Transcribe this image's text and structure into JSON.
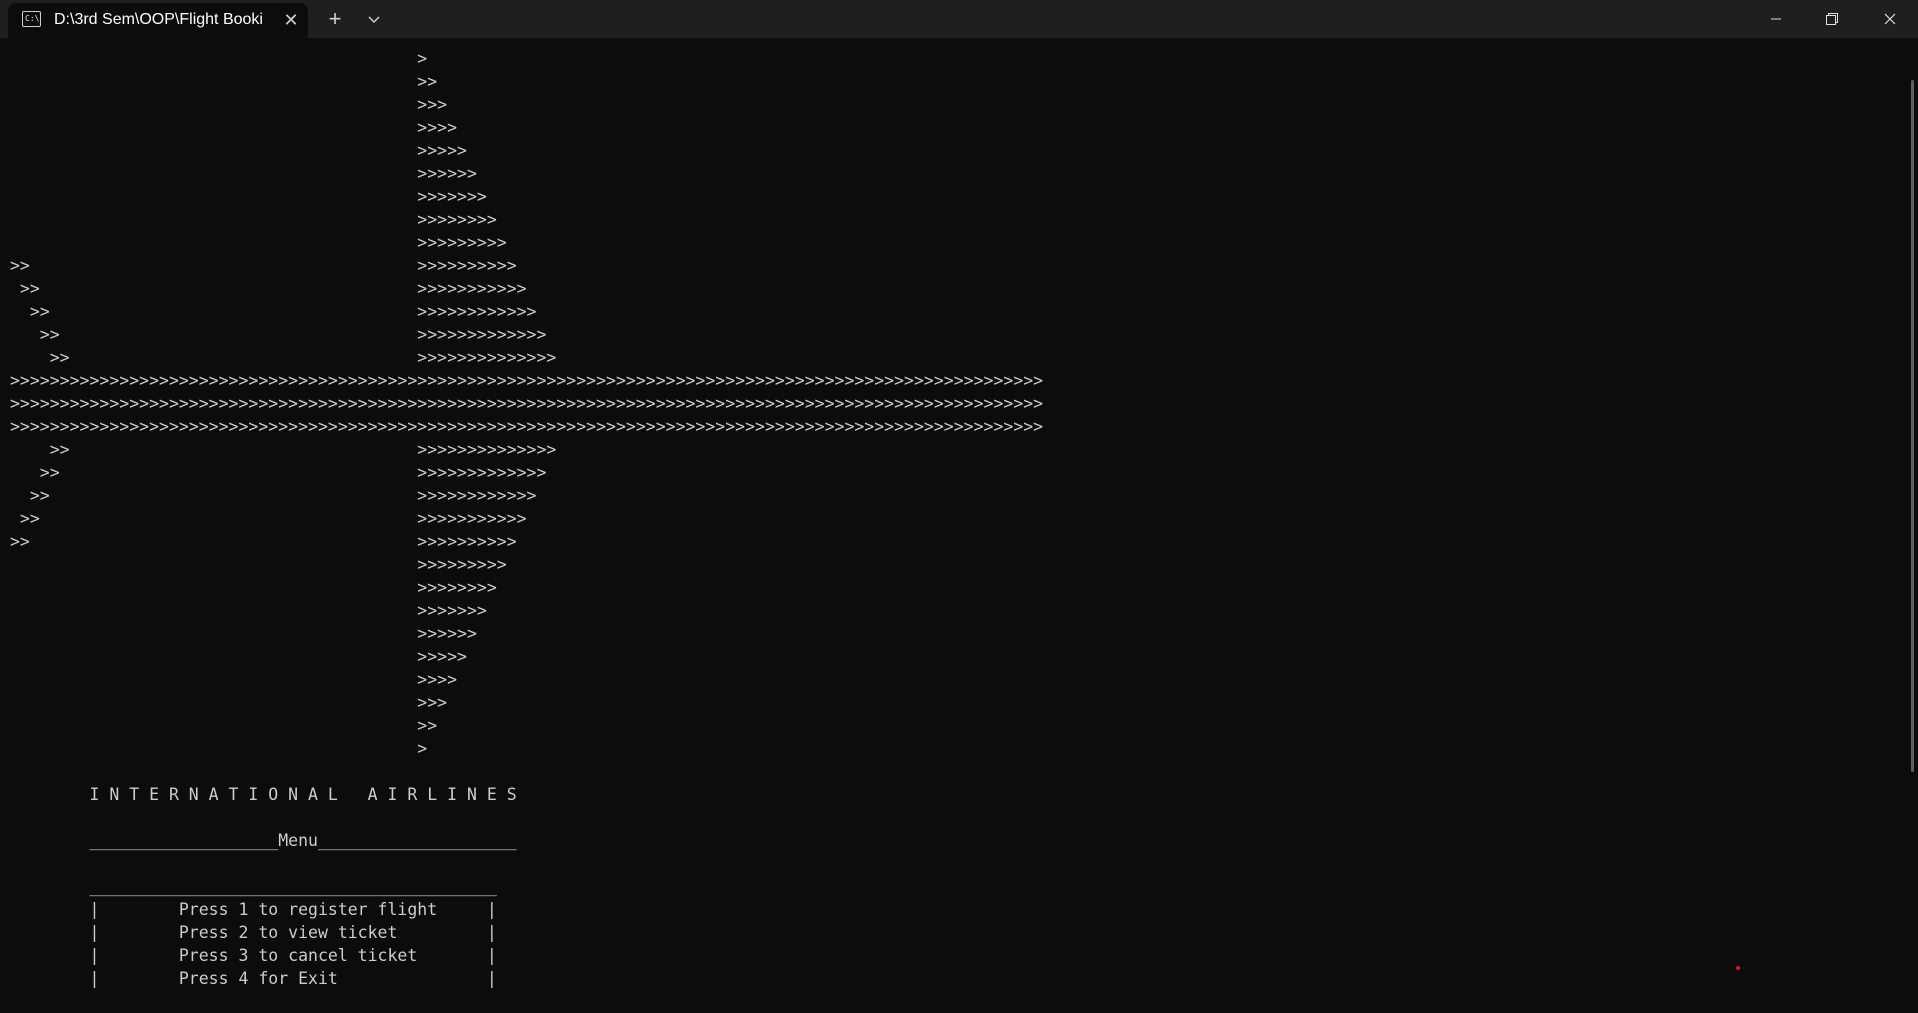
{
  "window": {
    "tab_title": "D:\\3rd Sem\\OOP\\Flight Booki",
    "tab_icon_text": "C:\\",
    "close_tab_glyph": "✕",
    "new_tab_glyph": "+"
  },
  "terminal": {
    "output": ">\n>>\n>>>\n>>>>\n>>>>>\n>>>>>>\n>>>>>>>\n>>>>>>>>\n>>>>>>>>>\n>>>>>>>>>>\n>>>>>>>>>>>\n>>>>>>>>>>>>\n>>>>>>>>>>>>>\n>>>>>>>>>>>>>>\n>>>>>>>>>>>>>>>>>>>>>>>>>>>>>>>>>>>>>>>>>>>>>>>>>>>>>>>>>>>>>>>>>>>>>>>>>>>>>>>>>>>>>>>>>>>>>>>>>>>>>>>>\n>>>>>>>>>>>>>>>>>>>>>>>>>>>>>>>>>>>>>>>>>>>>>>>>>>>>>>>>>>>>>>>>>>>>>>>>>>>>>>>>>>>>>>>>>>>>>>>>>>>>>>>>\n>>>>>>>>>>>>>>>>>>>>>>>>>>>>>>>>>>>>>>>>>>>>>>>>>>>>>>>>>>>>>>>>>>>>>>>>>>>>>>>>>>>>>>>>>>>>>>>>>>>>>>>>\n>>>>>>>>>>>>>>\n>>>>>>>>>>>>>\n>>>>>>>>>>>>\n>>>>>>>>>>>\n>>>>>>>>>>\n>>>>>>>>>\n>>>>>>>>\n>>>>>>>\n>>>>>>\n>>>>>\n>>>>\n>>>\n>>\n>\n\n        I N T E R N A T I O N A L   A I R L I N E S\n\n        ___________________Menu____________________\n\n        _________________________________________\n        |        Press 1 to register flight     |\n        |        Press 2 to view ticket         |\n        |        Press 3 to cancel ticket       |\n        |        Press 4 for Exit               |"
  },
  "colors": {
    "background": "#0c0c0c",
    "titlebar": "#1f1f1f",
    "text": "#cccccc"
  }
}
